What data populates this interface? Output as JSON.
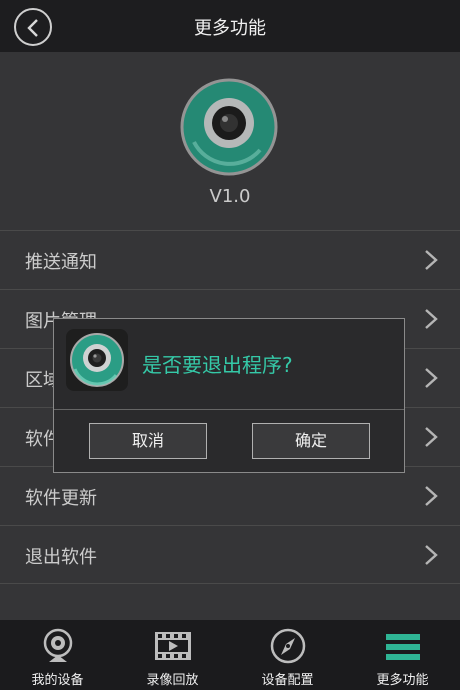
{
  "header": {
    "title": "更多功能"
  },
  "about": {
    "version": "V1.0"
  },
  "menu": {
    "items": [
      {
        "label": "推送通知"
      },
      {
        "label": "图片管理"
      },
      {
        "label": "区域"
      },
      {
        "label": "软件"
      },
      {
        "label": "软件更新"
      },
      {
        "label": "退出软件"
      }
    ]
  },
  "dialog": {
    "message": "是否要退出程序?",
    "cancel_label": "取消",
    "confirm_label": "确定"
  },
  "tabbar": {
    "tabs": [
      {
        "label": "我的设备",
        "icon": "webcam-icon"
      },
      {
        "label": "录像回放",
        "icon": "film-icon"
      },
      {
        "label": "设备配置",
        "icon": "compass-icon"
      },
      {
        "label": "更多功能",
        "icon": "menu-icon"
      }
    ]
  },
  "colors": {
    "accent": "#35c9a8",
    "header_bg": "#1d1d1f",
    "body_bg": "#3d3d3f"
  }
}
